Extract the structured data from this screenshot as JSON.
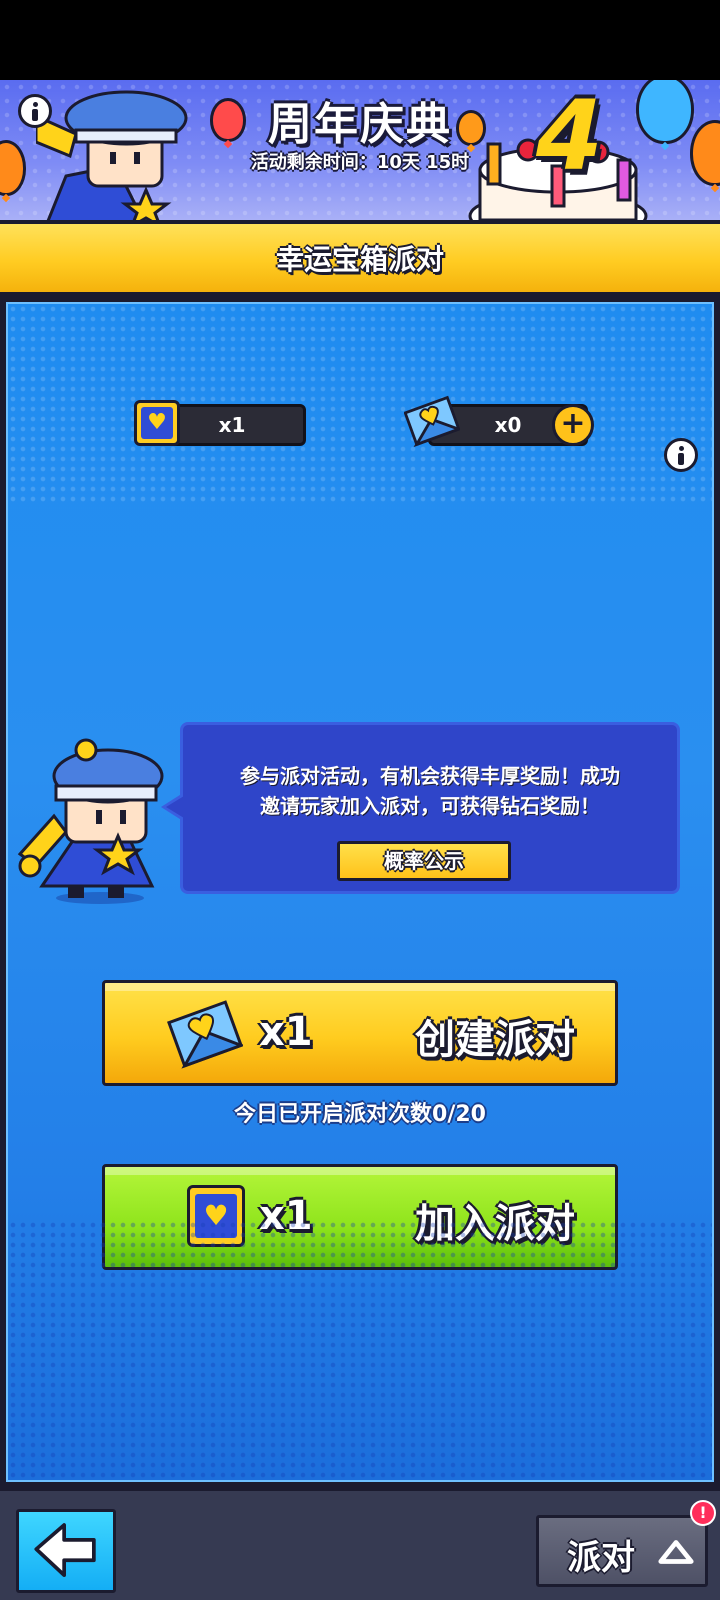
{
  "banner": {
    "title": "周年庆典",
    "time_label": "活动剩余时间：",
    "time_value": "10天 15时",
    "anniversary_number": "4"
  },
  "subtitle": "幸运宝箱派对",
  "counters": {
    "ticket": {
      "value": "x1",
      "icon": "heart-ticket-icon"
    },
    "envelope": {
      "value": "x0",
      "icon": "heart-envelope-icon"
    }
  },
  "bubble": {
    "line1": "参与派对活动，有机会获得丰厚奖励！成功",
    "line2": "邀请玩家加入派对，可获得钻石奖励！",
    "probability_button": "概率公示"
  },
  "create_party": {
    "cost": "x1",
    "label": "创建派对",
    "daily_count": "今日已开启派对次数0/20"
  },
  "join_party": {
    "cost": "x1",
    "label": "加入派对"
  },
  "bottom": {
    "party_label": "派对",
    "badge": "!"
  },
  "colors": {
    "accent_yellow": "#ffcc22",
    "accent_green": "#8fe41c",
    "panel_blue": "#1f8cf0",
    "back_button_cyan": "#14aef5",
    "badge_red": "#ff2e5a"
  }
}
